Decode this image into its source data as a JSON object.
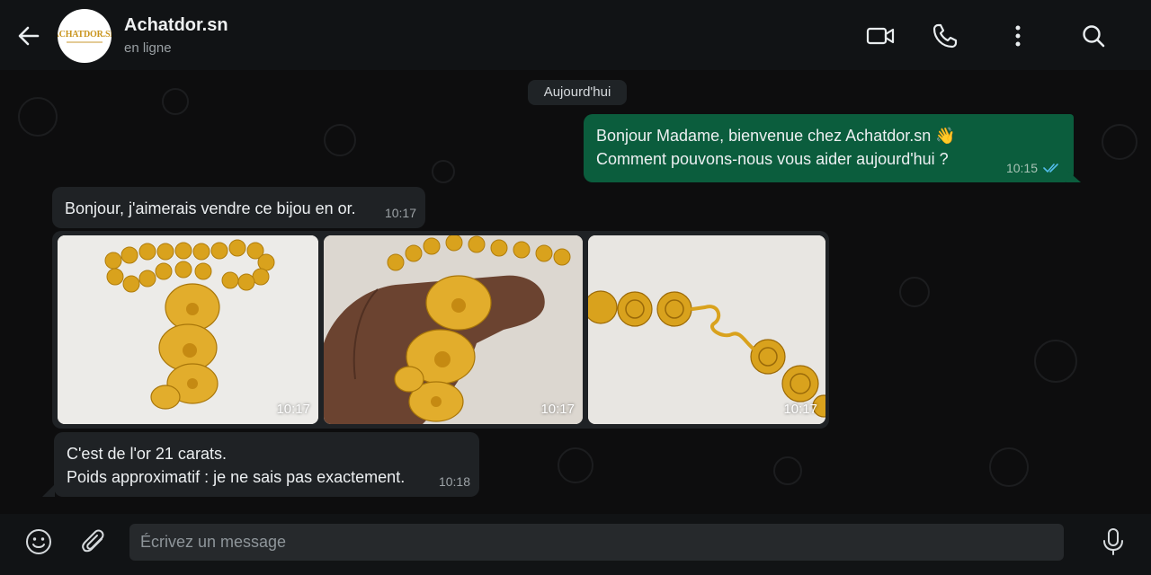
{
  "contact": {
    "name": "Achatdor.sn",
    "status": "en ligne",
    "avatar_logo": "ACHATDOR.SN"
  },
  "header_icons": [
    "back-arrow-icon",
    "video-call-icon",
    "phone-icon",
    "more-options-icon",
    "search-icon"
  ],
  "date_chip": "Aujourd'hui",
  "messages": [
    {
      "direction": "outgoing",
      "text": "Bonjour Madame, bienvenue chez Achatdor.sn 👋\nComment pouvons-nous vous aider aujourd'hui ?",
      "time": "10:15",
      "status": "read"
    },
    {
      "direction": "incoming",
      "text": "Bonjour, j'aimerais vendre ce bijou en or.",
      "time": "10:17"
    },
    {
      "direction": "incoming",
      "type": "photo-gallery",
      "photos": [
        {
          "subject": "gold necklace with flower pendant",
          "time": "10:17"
        },
        {
          "subject": "gold flower pendant held in hand",
          "time": "10:17"
        },
        {
          "subject": "gold filigree bead clasp",
          "time": "10:17"
        }
      ]
    },
    {
      "direction": "incoming",
      "text": "C'est de l'or 21 carats.\nPoids approximatif : je ne sais pas exactement.",
      "time": "10:18"
    }
  ],
  "composer": {
    "placeholder": "Écrivez un message",
    "value": ""
  },
  "colors": {
    "outgoing_bubble": "#0b5d3d",
    "incoming_bubble": "#1f2225",
    "header": "#111315",
    "read_ticks": "#53bdeb",
    "gold": "#d9a21d"
  }
}
